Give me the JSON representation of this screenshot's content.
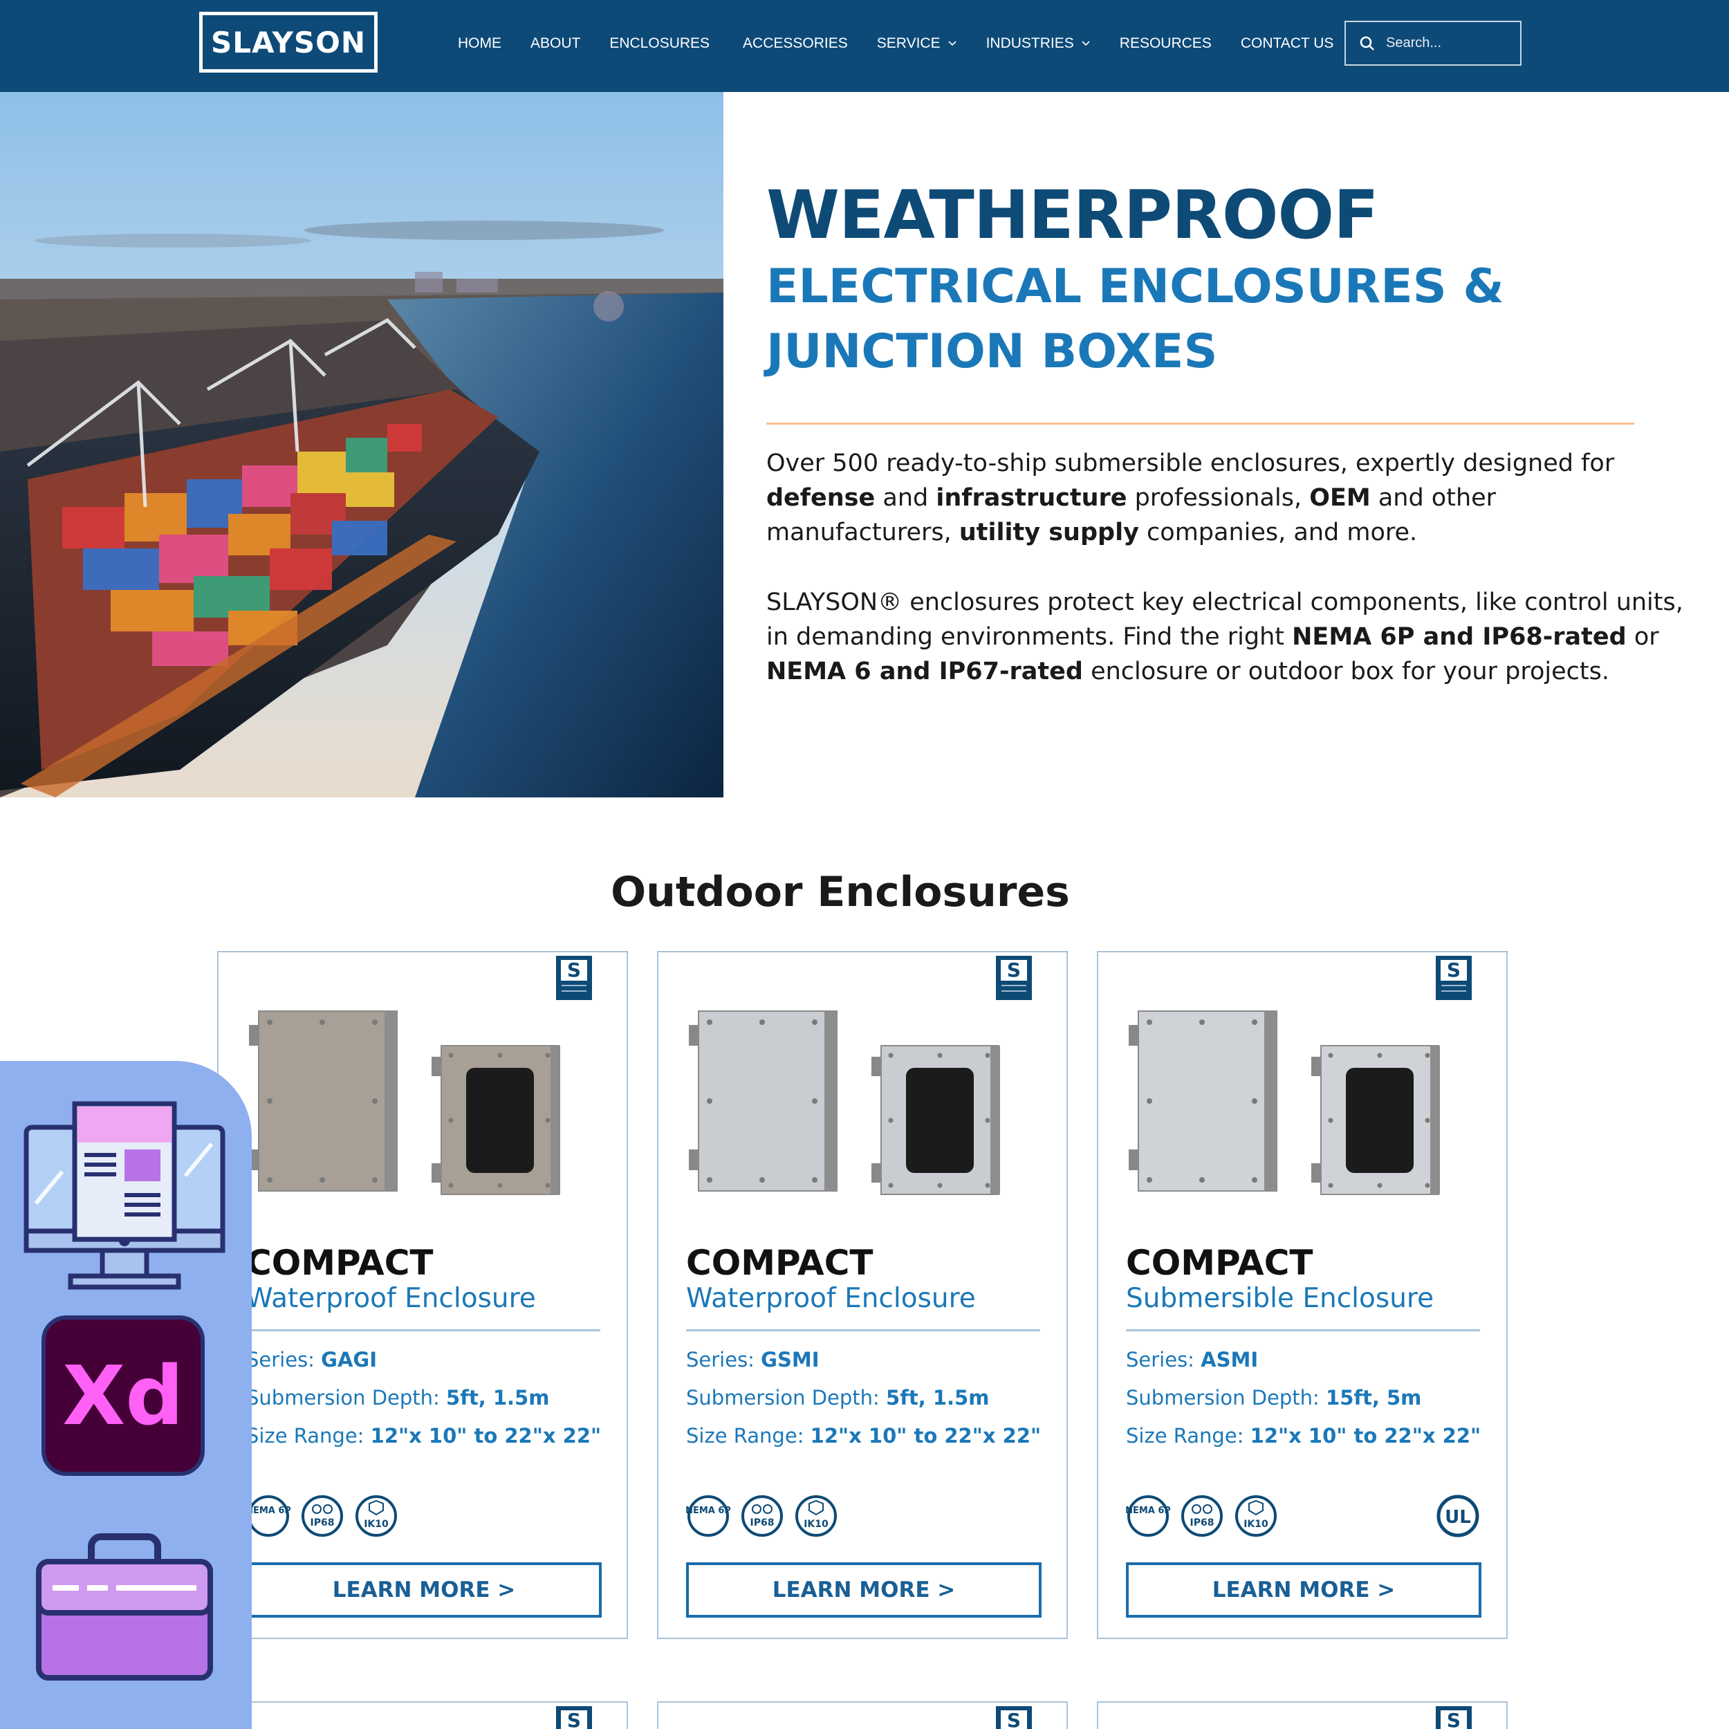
{
  "brand": {
    "logo_text": "SLAYSON"
  },
  "nav": {
    "items": [
      {
        "label": "HOME",
        "dropdown": false
      },
      {
        "label": "ABOUT",
        "dropdown": false
      },
      {
        "label": "ENCLOSURES",
        "dropdown": false
      },
      {
        "label": "ACCESSORIES",
        "dropdown": false
      },
      {
        "label": "SERVICE",
        "dropdown": true
      },
      {
        "label": "INDUSTRIES",
        "dropdown": true
      },
      {
        "label": "RESOURCES",
        "dropdown": false
      },
      {
        "label": "CONTACT US",
        "dropdown": false
      }
    ],
    "search": {
      "placeholder": "Search..."
    }
  },
  "hero": {
    "title": "WEATHERPROOF",
    "subtitle_line1": "ELECTRICAL ENCLOSURES &",
    "subtitle_line2": "JUNCTION BOXES",
    "p1": [
      {
        "t": "Over 500 ready-to-ship submersible enclosures, expertly designed for ",
        "b": false
      },
      {
        "t": "defense",
        "b": true
      },
      {
        "t": " and ",
        "b": false
      },
      {
        "t": "infrastructure",
        "b": true
      },
      {
        "t": " professionals, ",
        "b": false
      },
      {
        "t": "OEM",
        "b": true
      },
      {
        "t": " and other manufacturers, ",
        "b": false
      },
      {
        "t": "utility supply",
        "b": true
      },
      {
        "t": " companies, and more.",
        "b": false
      }
    ],
    "p2": [
      {
        "t": "SLAYSON® enclosures protect key electrical components, like control units, in demanding environments. Find the right ",
        "b": false
      },
      {
        "t": "NEMA 6P and IP68-rated",
        "b": true
      },
      {
        "t": " or ",
        "b": false
      },
      {
        "t": "NEMA 6 and IP67-rated",
        "b": true
      },
      {
        "t": " enclosure or outdoor box for your projects.",
        "b": false
      }
    ]
  },
  "section": {
    "title": "Outdoor Enclosures"
  },
  "cards": [
    {
      "name": "COMPACT",
      "type": "Waterproof Enclosure",
      "series_label": "Series: ",
      "series": "GAGI",
      "depth_label": "Submersion Depth: ",
      "depth": "5ft, 1.5m",
      "size_label": "Size Range: ",
      "size": "12\"x 10\" to 22\"x 22\"",
      "badge": "S",
      "certs": [
        "NEMA 6P",
        "IP68",
        "IK10"
      ],
      "ul": false,
      "button": "LEARN MORE >",
      "finish": "#a8a096"
    },
    {
      "name": "COMPACT",
      "type": "Waterproof Enclosure",
      "series_label": "Series: ",
      "series": "GSMI",
      "depth_label": "Submersion Depth: ",
      "depth": "5ft, 1.5m",
      "size_label": "Size Range: ",
      "size": "12\"x 10\" to 22\"x 22\"",
      "badge": "S",
      "certs": [
        "NEMA 6P",
        "IP68",
        "IK10"
      ],
      "ul": false,
      "button": "LEARN MORE >",
      "finish": "#c9ccd0"
    },
    {
      "name": "COMPACT",
      "type": "Submersible Enclosure",
      "series_label": "Series: ",
      "series": "ASMI",
      "depth_label": "Submersion Depth: ",
      "depth": "15ft, 5m",
      "size_label": "Size Range: ",
      "size": "12\"x 10\" to 22\"x 22\"",
      "badge": "S",
      "certs": [
        "NEMA 6P",
        "IP68",
        "IK10"
      ],
      "ul": true,
      "ul_text": "UL",
      "button": "LEARN MORE >",
      "finish": "#cfd2d6"
    }
  ],
  "colors": {
    "nav_bg": "#0d4a78",
    "title_navy": "#0e4a76",
    "accent_blue": "#1b78b8",
    "rule_orange": "#f7c18b",
    "panel_lavender": "#8fb0ef"
  },
  "overlay_icons": [
    "monitor-webpage-icon",
    "adobe-xd-icon",
    "briefcase-icon"
  ],
  "overlay_xd_text": "Xd"
}
